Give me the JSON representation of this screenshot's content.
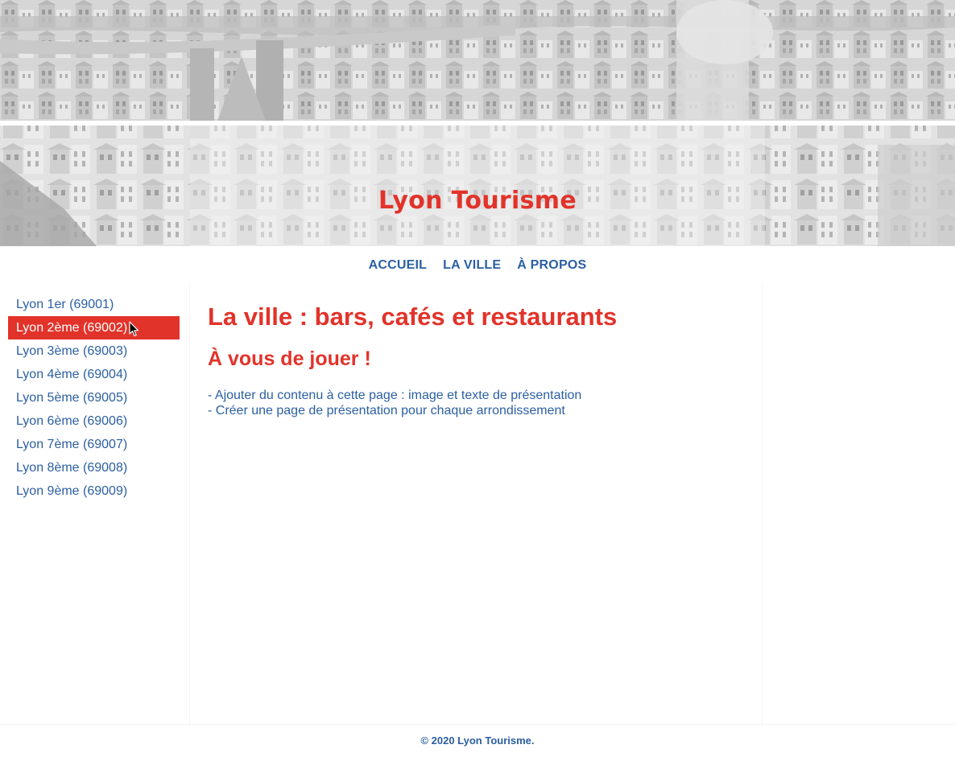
{
  "header": {
    "site_title": "Lyon Tourisme",
    "banner_image": "lyon-city-panorama-grayscale"
  },
  "nav": {
    "items": [
      {
        "label": "ACCUEIL"
      },
      {
        "label": "LA VILLE"
      },
      {
        "label": "À PROPOS"
      }
    ]
  },
  "sidebar": {
    "items": [
      {
        "label": "Lyon 1er (69001)"
      },
      {
        "label": "Lyon 2ème (69002)",
        "active": true
      },
      {
        "label": "Lyon 3ème (69003)"
      },
      {
        "label": "Lyon 4ème (69004)"
      },
      {
        "label": "Lyon 5ème (69005)"
      },
      {
        "label": "Lyon 6ème (69006)"
      },
      {
        "label": "Lyon 7ème (69007)"
      },
      {
        "label": "Lyon 8ème (69008)"
      },
      {
        "label": "Lyon 9ème (69009)"
      }
    ]
  },
  "main": {
    "title": "La ville : bars, cafés et restaurants",
    "subtitle": "À vous de jouer !",
    "lines": [
      "- Ajouter du contenu à cette page : image et texte de présentation",
      "- Créer une page de présentation pour chaque arrondissement"
    ]
  },
  "footer": {
    "text": "© 2020 Lyon Tourisme."
  },
  "colors": {
    "accent_red": "#e2332a",
    "link_blue": "#2b5fa3",
    "background": "#ffffff"
  },
  "icons": {
    "cursor": "mouse-pointer-icon"
  }
}
